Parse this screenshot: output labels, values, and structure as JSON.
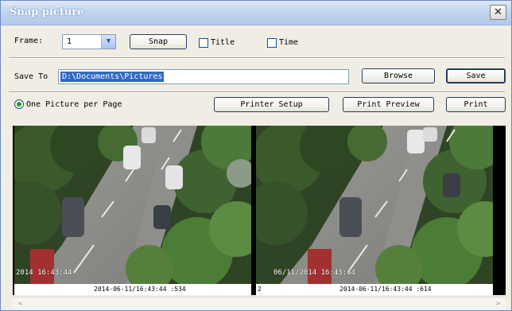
{
  "window": {
    "title": "Snap picture",
    "close_symbol": "✕"
  },
  "frame": {
    "label": "Frame:",
    "value": "1",
    "snap_label": "Snap",
    "title_checkbox": "Title",
    "time_checkbox": "Time"
  },
  "save": {
    "label": "Save To",
    "path": "D:\\Documents\\Pictures",
    "browse_label": "Browse",
    "save_label": "Save"
  },
  "print": {
    "one_per_page_label": "One Picture per Page",
    "printer_setup_label": "Printer Setup",
    "print_preview_label": "Print Preview",
    "print_label": "Print"
  },
  "pictures": [
    {
      "osd_time": "2014 16:43:44",
      "timestamp": "2014-06-11/16:43:44 :534",
      "index": ""
    },
    {
      "osd_time": "06/11/2014 16:43:44",
      "timestamp": "2014-06-11/16:43:44 :614",
      "index": "2"
    }
  ],
  "scrollbar": {
    "left_arrow": "<",
    "right_arrow": ">"
  }
}
